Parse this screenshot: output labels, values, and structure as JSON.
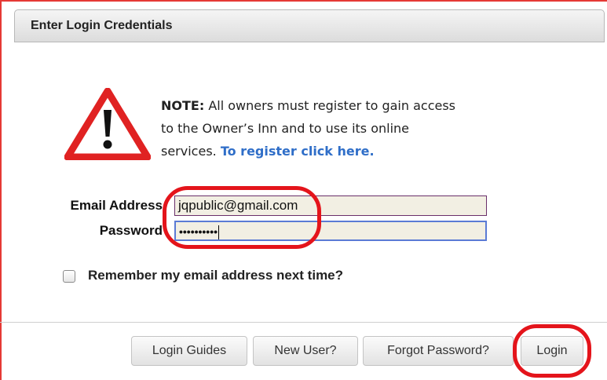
{
  "header": {
    "title": "Enter Login Credentials"
  },
  "note": {
    "label": "NOTE:",
    "text": "All owners must register to gain access to the Owner’s Inn and to use its online services.",
    "link": "To register click here."
  },
  "form": {
    "email_label": "Email Address",
    "email_value": "jqpublic@gmail.com",
    "password_label": "Password",
    "password_value": "••••••••••",
    "remember_label": "Remember my email address next time?",
    "remember_checked": false
  },
  "buttons": {
    "login_guides": "Login Guides",
    "new_user": "New User?",
    "forgot_password": "Forgot Password?",
    "login": "Login"
  },
  "colors": {
    "link": "#2f6ec8",
    "annotation": "#e4141b",
    "warning": "#e02222",
    "field_bg": "#f2efe3"
  },
  "icons": {
    "warning": "warning-triangle-icon",
    "checkbox": "checkbox-icon"
  }
}
